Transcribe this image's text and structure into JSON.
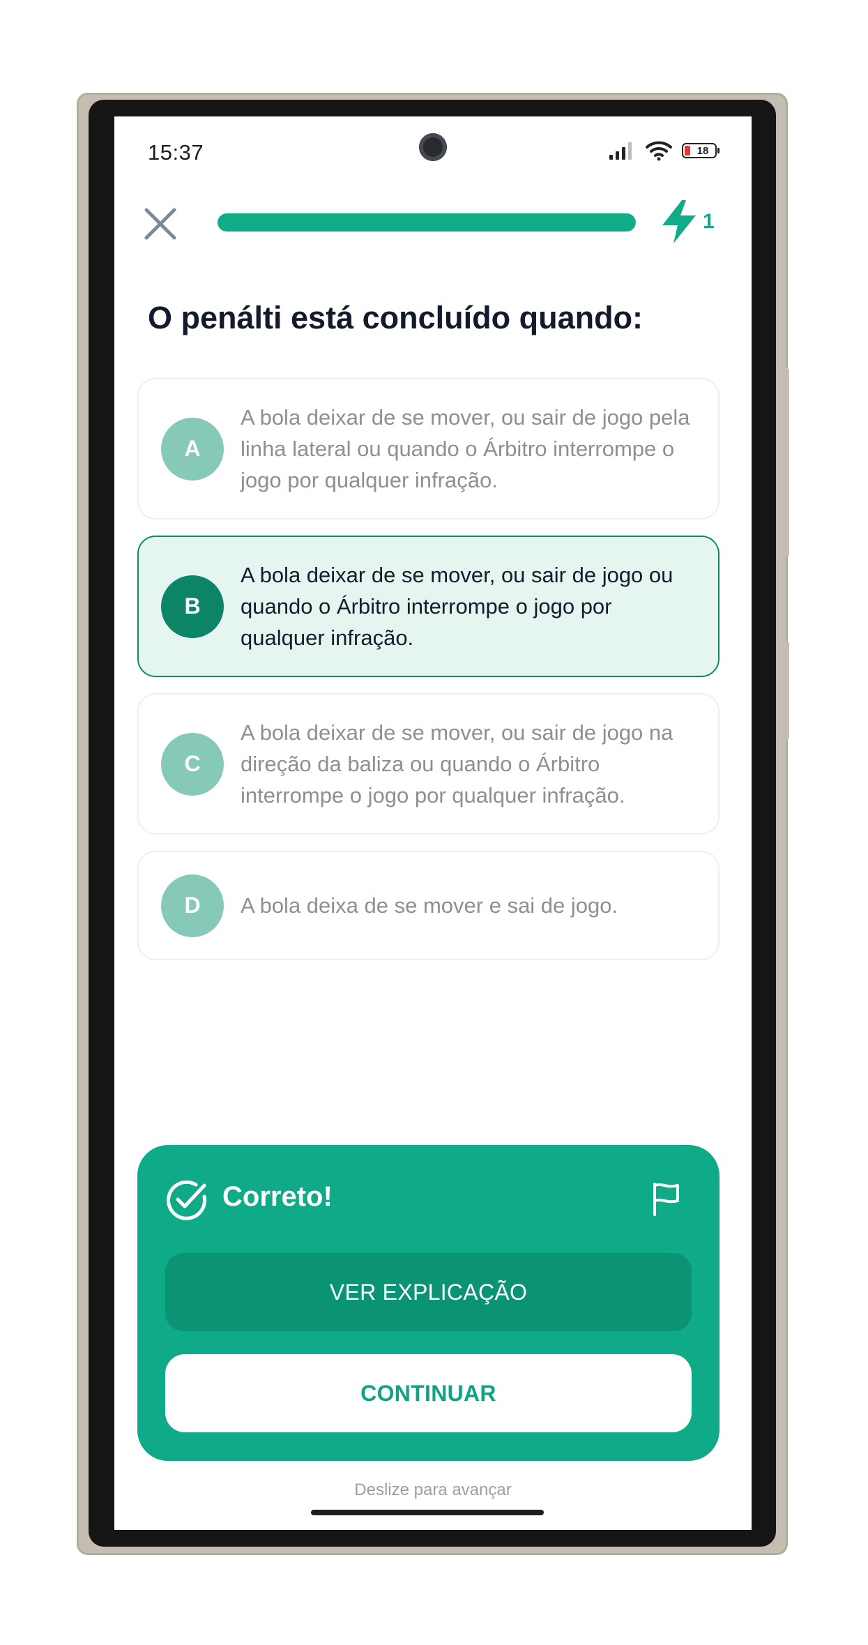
{
  "status_bar": {
    "time": "15:37",
    "battery_level": "18"
  },
  "header": {
    "close_icon": "close-icon",
    "progress_percent": 100,
    "streak_icon": "lightning-icon",
    "streak_count": "1"
  },
  "question": {
    "text": "O penálti está concluído quando:"
  },
  "options": [
    {
      "letter": "A",
      "text": "A bola deixar de se mover, ou sair de jogo pela linha lateral ou quando o Árbitro interrompe o jogo por qualquer infração.",
      "selected": false
    },
    {
      "letter": "B",
      "text": "A bola deixar de se mover, ou sair de jogo ou quando o Árbitro interrompe o jogo por qualquer infração.",
      "selected": true
    },
    {
      "letter": "C",
      "text": "A bola deixar de se mover, ou sair de jogo na direção da baliza ou quando o Árbitro interrompe o jogo por qualquer infração.",
      "selected": false
    },
    {
      "letter": "D",
      "text": "A bola deixa de se mover e sai de jogo.",
      "selected": false
    }
  ],
  "result": {
    "title": "Correto!",
    "check_icon": "check-circle-icon",
    "flag_icon": "flag-icon",
    "explain_label": "VER EXPLICAÇÃO",
    "continue_label": "CONTINUAR"
  },
  "footer": {
    "swipe_hint": "Deslize para avançar"
  },
  "colors": {
    "accent": "#10ac88",
    "accent_dark": "#0a9473",
    "selected_bg": "#e5f6f1",
    "question_text": "#131a2c"
  }
}
